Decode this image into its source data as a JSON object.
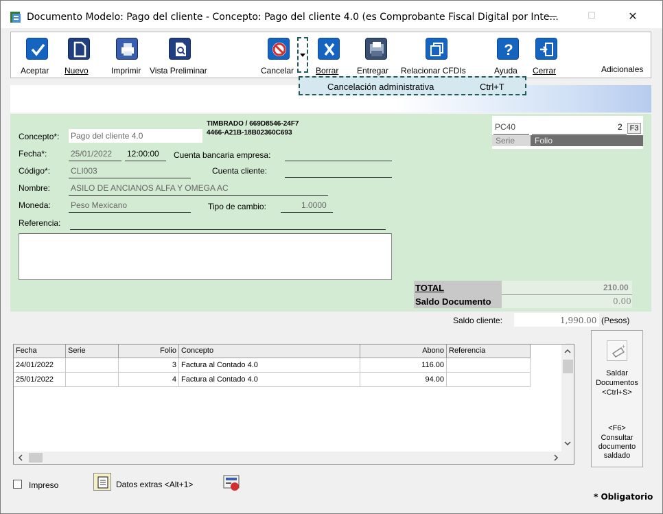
{
  "window": {
    "title": "Documento Modelo: Pago del cliente - Concepto: Pago del cliente 4.0 (es Comprobante Fiscal Digital por Inte...",
    "minimize": "—",
    "maximize": "☐",
    "close": "✕"
  },
  "toolbar": {
    "aceptar": "Aceptar",
    "nuevo": "Nuevo",
    "imprimir": "Imprimir",
    "vista_preliminar": "Vista Preliminar",
    "cancelar": "Cancelar",
    "borrar": "Borrar",
    "entregar": "Entregar",
    "relacionar": "Relacionar CFDIs",
    "ayuda": "Ayuda",
    "cerrar": "Cerrar",
    "adicionales": "Adicionales"
  },
  "dropdown": {
    "item": "Cancelación administrativa",
    "shortcut": "Ctrl+T"
  },
  "form": {
    "concepto_label": "Concepto*:",
    "concepto_value": "Pago del cliente 4.0",
    "timbrado": [
      "TIMBRADO / 669D8546-24F7",
      "4466-A21B-18B02360C693"
    ],
    "fecha_label": "Fecha*:",
    "fecha_value": "25/01/2022",
    "hora_value": "12:00:00",
    "cuenta_bancaria_label": "Cuenta bancaria empresa:",
    "codigo_label": "Código*:",
    "codigo_value": "CLI003",
    "cuenta_cliente_label": "Cuenta cliente:",
    "nombre_label": "Nombre:",
    "nombre_value": "ASILO DE ANCIANOS ALFA Y OMEGA AC",
    "moneda_label": "Moneda:",
    "moneda_value": "Peso Mexicano",
    "tipo_cambio_label": "Tipo de cambio:",
    "tipo_cambio_value": "1.0000",
    "referencia_label": "Referencia:",
    "serie_box": {
      "serie_value": "PC40",
      "folio_value": "2",
      "f3": "F3",
      "serie_label": "Serie",
      "folio_label": "Folio"
    },
    "total_label": "TOTAL",
    "total_value": "210.00",
    "saldo_doc_label": "Saldo Documento",
    "saldo_doc_value": "0.00"
  },
  "saldo_cliente": {
    "label": "Saldo cliente:",
    "value": "1,990.00",
    "currency": "(Pesos)"
  },
  "table": {
    "headers": [
      "Fecha",
      "Serie",
      "Folio",
      "Concepto",
      "Abono",
      "Referencia"
    ],
    "rows": [
      [
        "24/01/2022",
        "",
        "3",
        "Factura al Contado 4.0",
        "116.00",
        ""
      ],
      [
        "25/01/2022",
        "",
        "4",
        "Factura al Contado 4.0",
        "94.00",
        ""
      ]
    ]
  },
  "side": {
    "saldar": "Saldar",
    "documentos": "Documentos",
    "ctrl_s": "<Ctrl+S>",
    "f6": "<F6>",
    "consultar": "Consultar",
    "documento": "documento",
    "saldado": "saldado"
  },
  "bottom": {
    "impreso": "Impreso",
    "datos_extras": "Datos extras  <Alt+1>",
    "obligatorio": "* Obligatorio"
  },
  "colors": {
    "form_bg": "#d3ead3",
    "accent_blue": "#1565c0",
    "dropdown_bg": "#d6e8ef"
  }
}
